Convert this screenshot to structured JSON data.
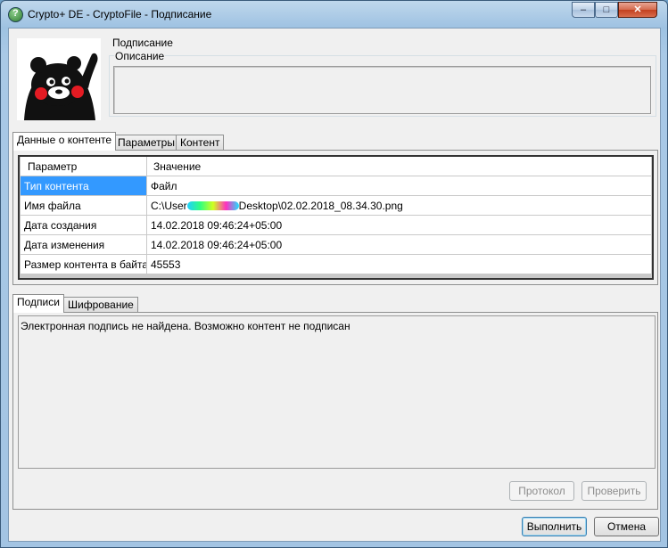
{
  "window": {
    "title": "Crypto+ DE - CryptoFile - Подписание"
  },
  "header": {
    "section_label": "Подписание",
    "description_legend": "Описание",
    "description_value": ""
  },
  "content_tabs": [
    {
      "label": "Данные о контенте",
      "active": true
    },
    {
      "label": "Параметры",
      "active": false
    },
    {
      "label": "Контент",
      "active": false
    }
  ],
  "grid": {
    "columns": [
      "Параметр",
      "Значение"
    ],
    "rows": [
      {
        "param": "Тип контента",
        "value": "Файл",
        "selected": true
      },
      {
        "param": "Имя файла",
        "value_prefix": "C:\\User",
        "value_suffix": "Desktop\\02.02.2018_08.34.30.png",
        "selected": false
      },
      {
        "param": "Дата создания",
        "value": "14.02.2018 09:46:24+05:00",
        "selected": false
      },
      {
        "param": "Дата изменения",
        "value": "14.02.2018 09:46:24+05:00",
        "selected": false
      },
      {
        "param": "Размер контента в байтах",
        "value": "45553",
        "selected": false
      }
    ]
  },
  "signature_tabs": [
    {
      "label": "Подписи",
      "active": true
    },
    {
      "label": "Шифрование",
      "active": false
    }
  ],
  "signature_message": "Электронная подпись не найдена. Возможно контент не подписан",
  "buttons": {
    "protocol": "Протокол",
    "verify": "Проверить",
    "execute": "Выполнить",
    "cancel": "Отмена"
  },
  "colors": {
    "selection": "#3399ff",
    "window_frame": "#a3c4e3",
    "close_button": "#c2401f"
  }
}
